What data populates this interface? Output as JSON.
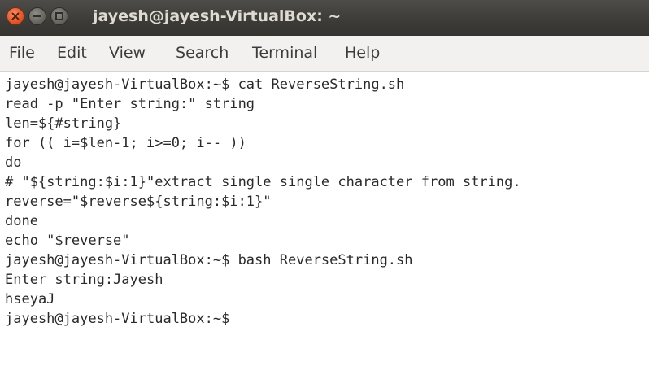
{
  "window": {
    "title": "jayesh@jayesh-VirtualBox: ~"
  },
  "menu": {
    "items": [
      {
        "mnemonic": "F",
        "rest": "ile"
      },
      {
        "mnemonic": "E",
        "rest": "dit"
      },
      {
        "mnemonic": "V",
        "rest": "iew"
      },
      {
        "mnemonic": "S",
        "rest": "earch"
      },
      {
        "mnemonic": "T",
        "rest": "erminal"
      },
      {
        "mnemonic": "H",
        "rest": "elp"
      }
    ]
  },
  "terminal": {
    "lines": [
      "jayesh@jayesh-VirtualBox:~$ cat ReverseString.sh",
      "read -p \"Enter string:\" string",
      "len=${#string}",
      "for (( i=$len-1; i>=0; i-- ))",
      "do",
      "# \"${string:$i:1}\"extract single single character from string.",
      "reverse=\"$reverse${string:$i:1}\"",
      "done",
      "echo \"$reverse\"",
      "jayesh@jayesh-VirtualBox:~$ bash ReverseString.sh",
      "Enter string:Jayesh",
      "hseyaJ",
      "jayesh@jayesh-VirtualBox:~$"
    ]
  }
}
